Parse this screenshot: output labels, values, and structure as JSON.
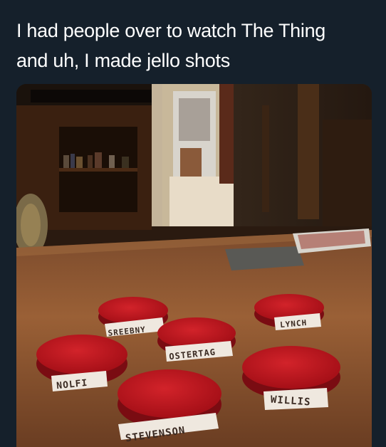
{
  "tweet": {
    "line1": "I had people over to watch The Thing",
    "line2": "and uh, I made jello shots"
  },
  "photo": {
    "cup_labels": {
      "sreebny": "SREEBNY",
      "lynch": "LYNCH",
      "ostertag": "OSTERTAG",
      "nolfi": "NOLFI",
      "willis": "WILLIS",
      "stevenson": "STEVENSON"
    }
  }
}
